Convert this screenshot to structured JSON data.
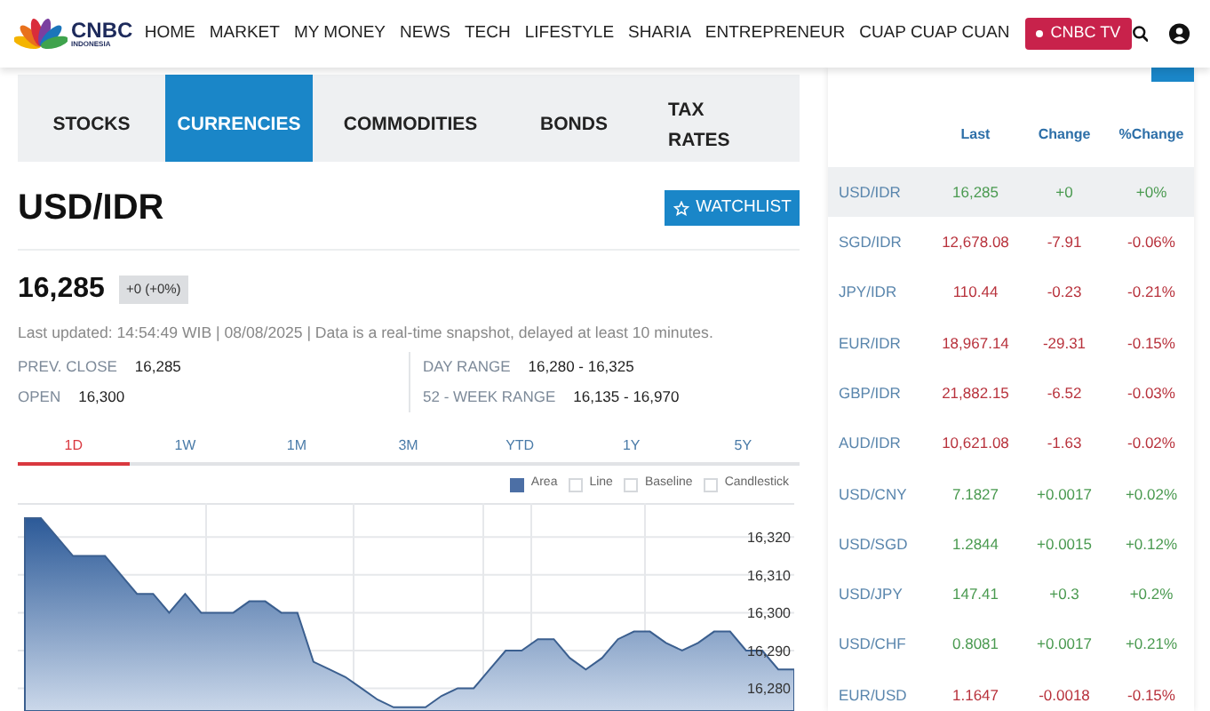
{
  "header": {
    "logo": {
      "name": "CNBC",
      "subtitle": "INDONESIA"
    },
    "nav": [
      "HOME",
      "MARKET",
      "MY MONEY",
      "NEWS",
      "TECH",
      "LIFESTYLE",
      "SHARIA",
      "ENTREPRENEUR",
      "CUAP CUAP CUAN"
    ],
    "live_button": "CNBC TV"
  },
  "tabs": [
    {
      "label": "STOCKS",
      "selected": false
    },
    {
      "label": "CURRENCIES",
      "selected": true
    },
    {
      "label": "COMMODITIES",
      "selected": false
    },
    {
      "label": "BONDS",
      "selected": false
    },
    {
      "label": "TAX RATES",
      "selected": false
    }
  ],
  "quote": {
    "symbol": "USD/IDR",
    "watchlist_button": "WATCHLIST",
    "price": "16,285",
    "change": "+0 (+0%)",
    "updated": "Last updated: 14:54:49 WIB | 08/08/2025 | Data is a real-time snapshot, delayed at least 10 minutes.",
    "stats": [
      {
        "label": "PREV. CLOSE",
        "value": "16,285"
      },
      {
        "label": "DAY RANGE",
        "value": "16,280 - 16,325"
      },
      {
        "label": "OPEN",
        "value": "16,300"
      },
      {
        "label": "52 - WEEK RANGE",
        "value": "16,135 - 16,970"
      }
    ]
  },
  "periods": [
    {
      "label": "1D",
      "selected": true
    },
    {
      "label": "1W",
      "selected": false
    },
    {
      "label": "1M",
      "selected": false
    },
    {
      "label": "3M",
      "selected": false
    },
    {
      "label": "YTD",
      "selected": false
    },
    {
      "label": "1Y",
      "selected": false
    },
    {
      "label": "5Y",
      "selected": false
    }
  ],
  "chart_types": [
    {
      "label": "Area",
      "selected": true
    },
    {
      "label": "Line",
      "selected": false
    },
    {
      "label": "Baseline",
      "selected": false
    },
    {
      "label": "Candlestick",
      "selected": false
    }
  ],
  "chart_data": {
    "type": "area",
    "grid": true,
    "ylim": [
      16274,
      16329
    ],
    "yticks": [
      {
        "value": 16320,
        "label": "16,320"
      },
      {
        "value": 16310,
        "label": "16,310"
      },
      {
        "value": 16300,
        "label": "16,300"
      },
      {
        "value": 16290,
        "label": "16,290"
      },
      {
        "value": 16280,
        "label": "16,280"
      }
    ],
    "series": [
      {
        "color": "#3b5f8f",
        "values": [
          16325,
          16325,
          16320,
          16315,
          16315,
          16315,
          16310,
          16305,
          16305,
          16300,
          16305,
          16300,
          16300,
          16300,
          16303,
          16303,
          16300,
          16300,
          16287,
          16285,
          16283,
          16280,
          16277,
          16275,
          16275,
          16275,
          16278,
          16280,
          16280,
          16285,
          16290,
          16290,
          16293,
          16293,
          16288,
          16285,
          16288,
          16293,
          16295,
          16295,
          16292,
          16290,
          16292,
          16295,
          16295,
          16290,
          16290,
          16285,
          16285
        ]
      }
    ]
  },
  "table": {
    "columns": [
      "Last",
      "Change",
      "%Change"
    ],
    "rows": [
      {
        "pair": "USD/IDR",
        "last": "16,285",
        "change": "+0",
        "pct": "+0%",
        "color": "#4a9a50",
        "selected": true
      },
      {
        "pair": "SGD/IDR",
        "last": "12,678.08",
        "change": "-7.91",
        "pct": "-0.06%",
        "color": "#b8323c",
        "selected": false
      },
      {
        "pair": "JPY/IDR",
        "last": "110.44",
        "change": "-0.23",
        "pct": "-0.21%",
        "color": "#b8323c",
        "selected": false
      },
      {
        "pair": "EUR/IDR",
        "last": "18,967.14",
        "change": "-29.31",
        "pct": "-0.15%",
        "color": "#b8323c",
        "selected": false
      },
      {
        "pair": "GBP/IDR",
        "last": "21,882.15",
        "change": "-6.52",
        "pct": "-0.03%",
        "color": "#b8323c",
        "selected": false
      },
      {
        "pair": "AUD/IDR",
        "last": "10,621.08",
        "change": "-1.63",
        "pct": "-0.02%",
        "color": "#b8323c",
        "selected": false
      },
      {
        "pair": "USD/CNY",
        "last": "7.1827",
        "change": "+0.0017",
        "pct": "+0.02%",
        "color": "#4a9a50",
        "selected": false
      },
      {
        "pair": "USD/SGD",
        "last": "1.2844",
        "change": "+0.0015",
        "pct": "+0.12%",
        "color": "#4a9a50",
        "selected": false
      },
      {
        "pair": "USD/JPY",
        "last": "147.41",
        "change": "+0.3",
        "pct": "+0.2%",
        "color": "#4a9a50",
        "selected": false
      },
      {
        "pair": "USD/CHF",
        "last": "0.8081",
        "change": "+0.0017",
        "pct": "+0.21%",
        "color": "#4a9a50",
        "selected": false
      },
      {
        "pair": "EUR/USD",
        "last": "1.1647",
        "change": "-0.0018",
        "pct": "-0.15%",
        "color": "#b8323c",
        "selected": false
      }
    ]
  }
}
